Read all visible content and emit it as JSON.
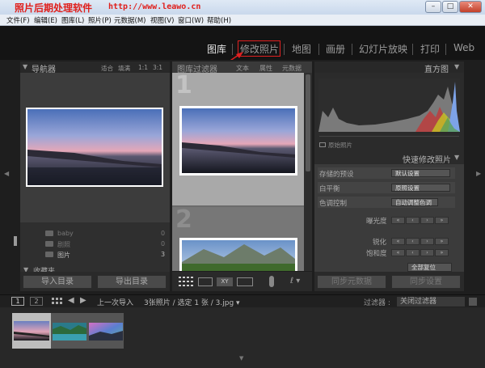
{
  "titlebar": {
    "app_name": "照片后期处理软件",
    "url": "http://www.leawo.cn",
    "min": "–",
    "max": "□",
    "close": "✕"
  },
  "menu": [
    "文件(F)",
    "编辑(E)",
    "图库(L)",
    "照片(P)",
    "元数据(M)",
    "视图(V)",
    "窗口(W)",
    "帮助(H)"
  ],
  "modules": [
    "图库",
    "修改照片",
    "地图",
    "画册",
    "幻灯片放映",
    "打印",
    "Web"
  ],
  "left_panel": {
    "navigator": {
      "title": "导航器",
      "zoom_fit": "适合",
      "zoom_fill": "填满",
      "zoom_1": "1:1",
      "zoom_3": "3:1"
    },
    "folders": [
      {
        "name": "baby",
        "count": "0"
      },
      {
        "name": "剧照",
        "count": "0"
      },
      {
        "name": "图片",
        "count": "3"
      }
    ],
    "collections_title": "收藏夹",
    "import_button": "导入目录",
    "export_button": "导出目录"
  },
  "filter_bar": {
    "title": "图库过滤器",
    "text": "文本",
    "attribute": "属性",
    "metadata": "元数据"
  },
  "grid": {
    "cell1_index": "1",
    "cell2_index": "2"
  },
  "right_panel": {
    "histogram_title": "直方图",
    "original_photo": "原始照片",
    "quick_develop_title": "快速修改照片",
    "saved_preset_label": "存储的预设",
    "saved_preset_value": "默认设置",
    "white_balance_label": "白平衡",
    "white_balance_value": "原照设置",
    "tone_control_label": "色调控制",
    "auto_tone": "自动调整色调",
    "exposure_label": "曝光度",
    "sharpen_label": "锐化",
    "saturation_label": "饱和度",
    "reset_label": "全部复位",
    "sync_metadata": "同步元数据",
    "sync_settings": "同步设置"
  },
  "filmstrip": {
    "page1": "1",
    "page2": "2",
    "source": "上一次导入",
    "summary": "3张照片 / 选定 1 张 / 3.jpg ▾",
    "filter_label": "过滤器 :",
    "filter_value": "关闭过滤器"
  },
  "colors": {
    "accent_red": "#e02020",
    "panel": "#343434",
    "background": "#141414"
  }
}
